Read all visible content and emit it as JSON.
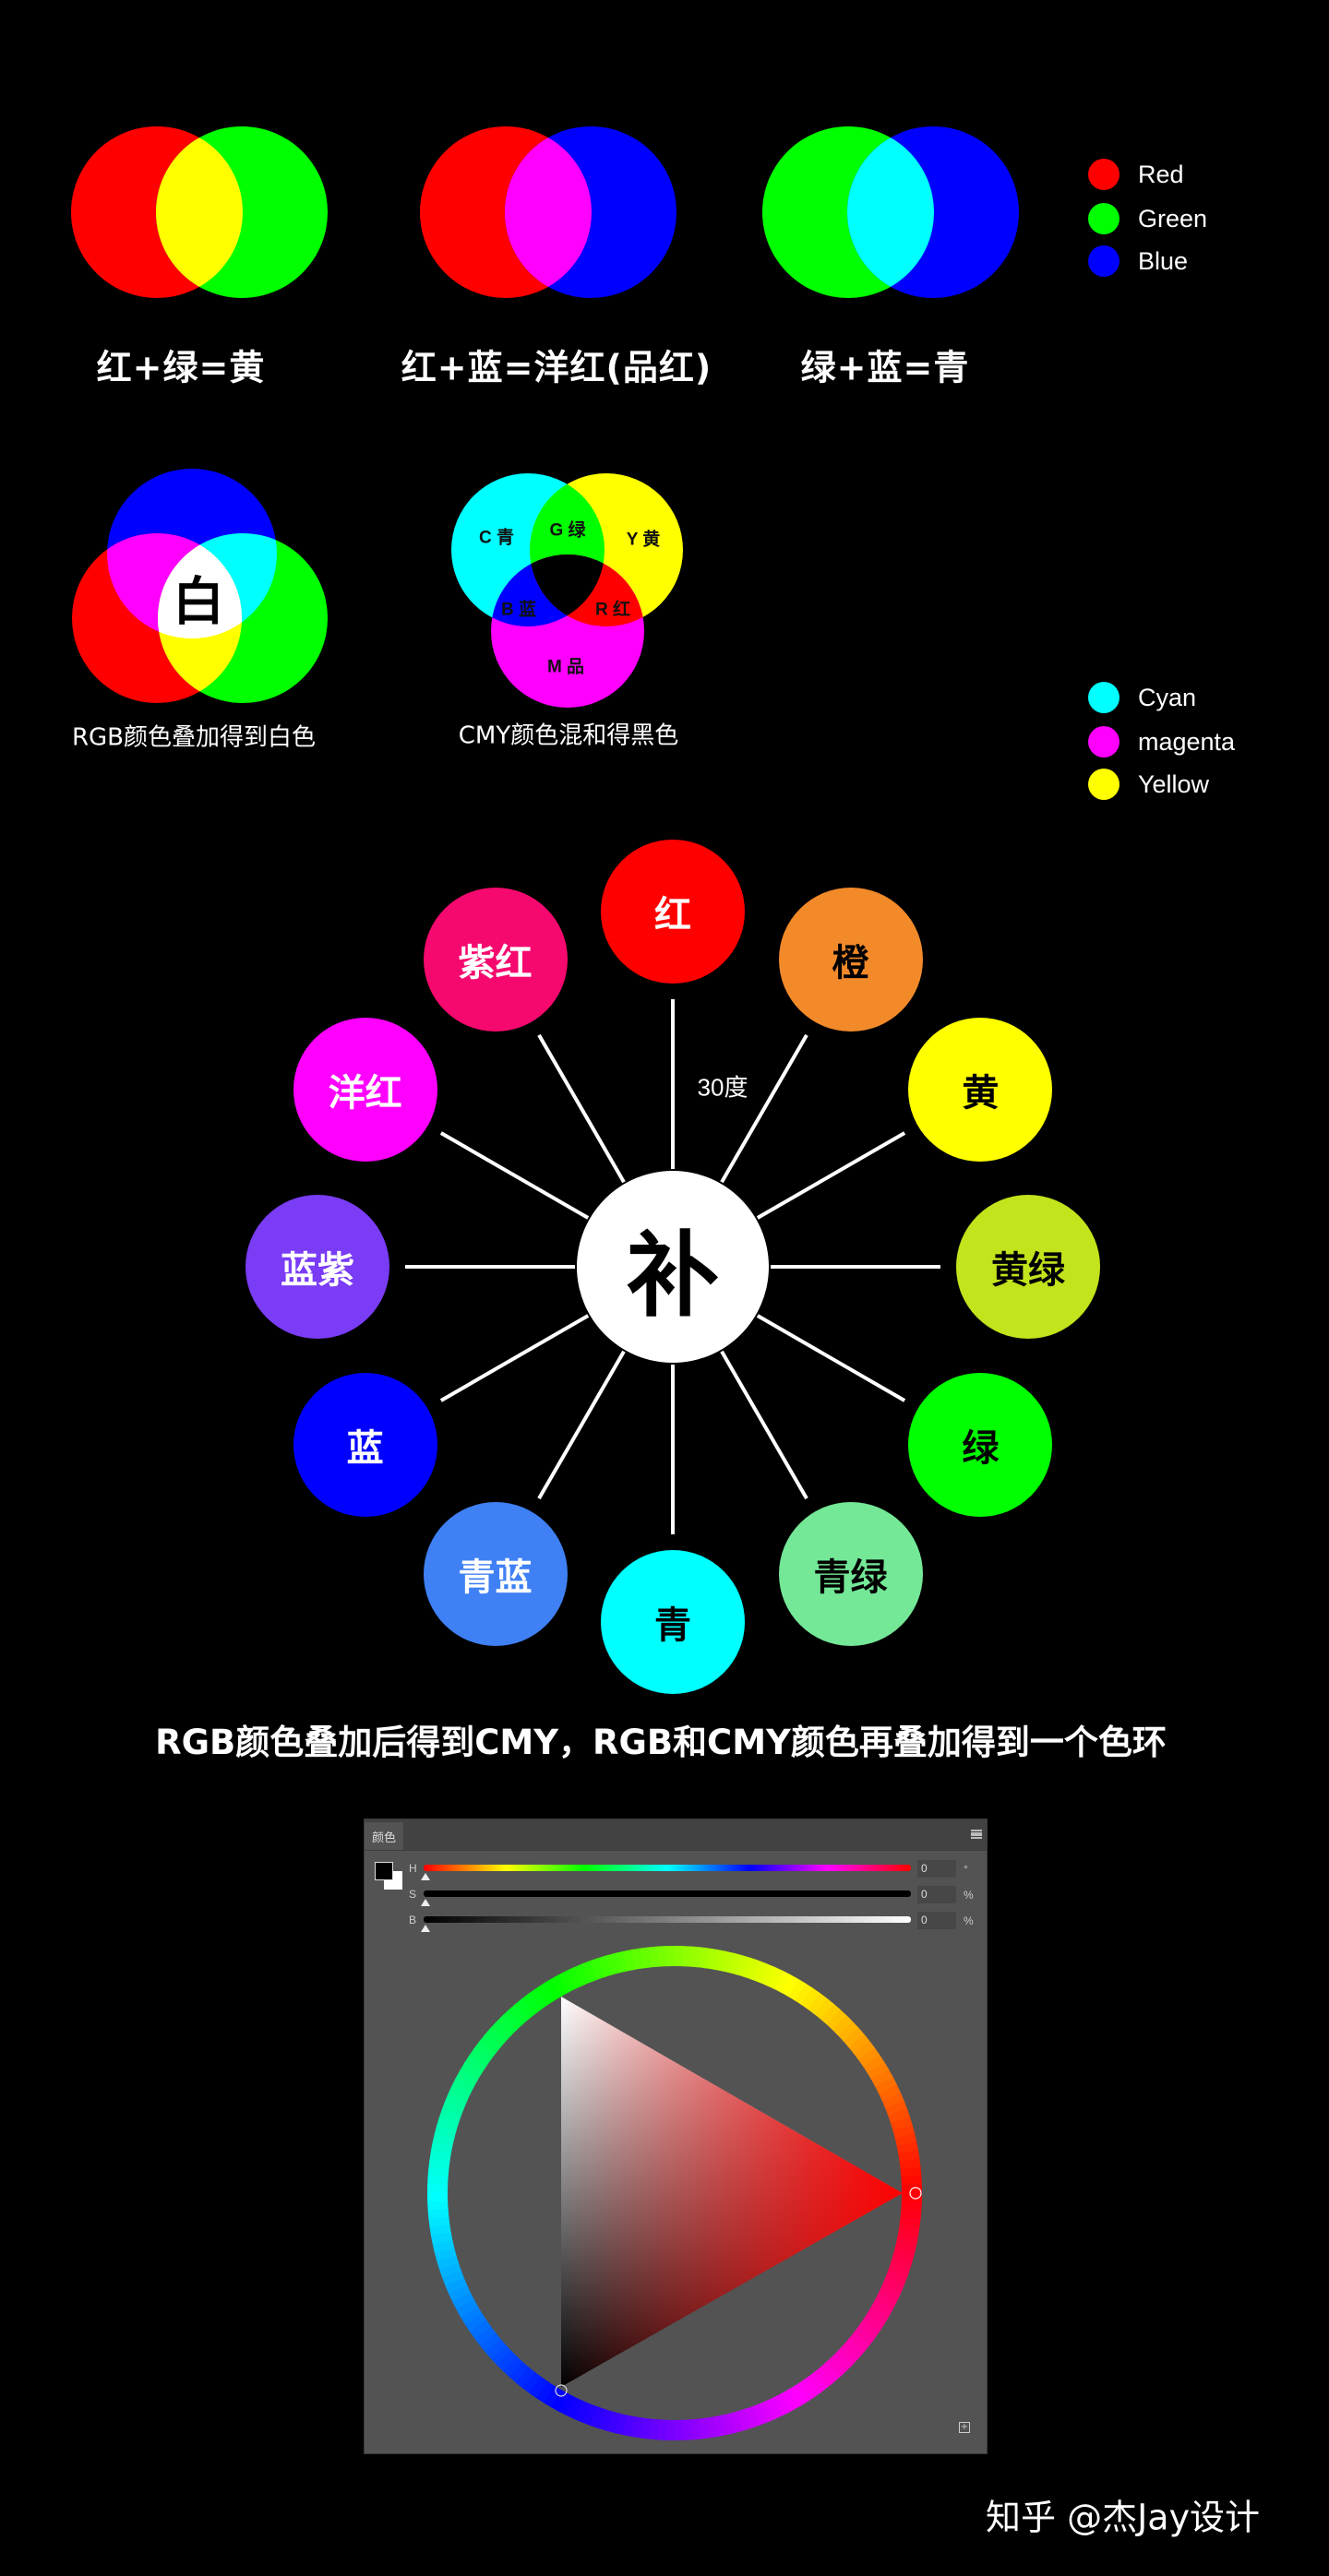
{
  "colors": {
    "red": "#ff0000",
    "green": "#00ff00",
    "blue": "#0000ff",
    "cyan": "#00ffff",
    "magenta": "#ff00ff",
    "yellow": "#ffff00",
    "white": "#ffffff",
    "black": "#000000"
  },
  "pairs": [
    {
      "left_color": "#ff0000",
      "right_color": "#00ff00",
      "mix_color": "#ffff00",
      "caption": "红+绿=黄"
    },
    {
      "left_color": "#ff0000",
      "right_color": "#0000ff",
      "mix_color": "#ff00ff",
      "caption": "红+蓝=洋红(品红)"
    },
    {
      "left_color": "#00ff00",
      "right_color": "#0000ff",
      "mix_color": "#00ffff",
      "caption": "绿+蓝=青"
    }
  ],
  "legend_rgb": [
    {
      "label": "Red",
      "color": "#ff0000"
    },
    {
      "label": "Green",
      "color": "#00ff00"
    },
    {
      "label": "Blue",
      "color": "#0000ff"
    }
  ],
  "legend_cmy": [
    {
      "label": "Cyan",
      "color": "#00ffff"
    },
    {
      "label": "magenta",
      "color": "#ff00ff"
    },
    {
      "label": "Yellow",
      "color": "#ffff00"
    }
  ],
  "rgb_venn": {
    "center_label": "白",
    "caption": "RGB颜色叠加得到白色"
  },
  "cmy_venn": {
    "labels": {
      "c": "C 青",
      "g": "G 绿",
      "y": "Y 黄",
      "b": "B 蓝",
      "r": "R 红",
      "m": "M 品"
    },
    "caption": "CMY颜色混和得黑色"
  },
  "color_wheel": {
    "hub_label": "补",
    "angle_label": "30度",
    "nodes": [
      {
        "label": "红",
        "color": "#ff0000",
        "text_color": "#ffffff"
      },
      {
        "label": "橙",
        "color": "#f28a2a",
        "text_color": "#000000"
      },
      {
        "label": "黄",
        "color": "#ffff00",
        "text_color": "#000000"
      },
      {
        "label": "黄绿",
        "color": "#c2e41c",
        "text_color": "#000000"
      },
      {
        "label": "绿",
        "color": "#00ff00",
        "text_color": "#000000"
      },
      {
        "label": "青绿",
        "color": "#74e897",
        "text_color": "#000000"
      },
      {
        "label": "青",
        "color": "#00ffff",
        "text_color": "#000000"
      },
      {
        "label": "青蓝",
        "color": "#3f80f4",
        "text_color": "#ffffff"
      },
      {
        "label": "蓝",
        "color": "#0000ff",
        "text_color": "#ffffff"
      },
      {
        "label": "蓝紫",
        "color": "#7a3cf5",
        "text_color": "#ffffff"
      },
      {
        "label": "洋红",
        "color": "#ff00ff",
        "text_color": "#ffffff"
      },
      {
        "label": "紫红",
        "color": "#f5096e",
        "text_color": "#ffffff"
      }
    ],
    "caption": "RGB颜色叠加后得到CMY，RGB和CMY颜色再叠加得到一个色环"
  },
  "color_panel": {
    "tab_label": "颜色",
    "foreground": "#000000",
    "background": "#ffffff",
    "sliders": [
      {
        "letter": "H",
        "value": "0",
        "unit": "°"
      },
      {
        "letter": "S",
        "value": "0",
        "unit": "%"
      },
      {
        "letter": "B",
        "value": "0",
        "unit": "%"
      }
    ],
    "panel_bg": "#535353"
  },
  "watermark": "知乎 @杰Jay设计"
}
